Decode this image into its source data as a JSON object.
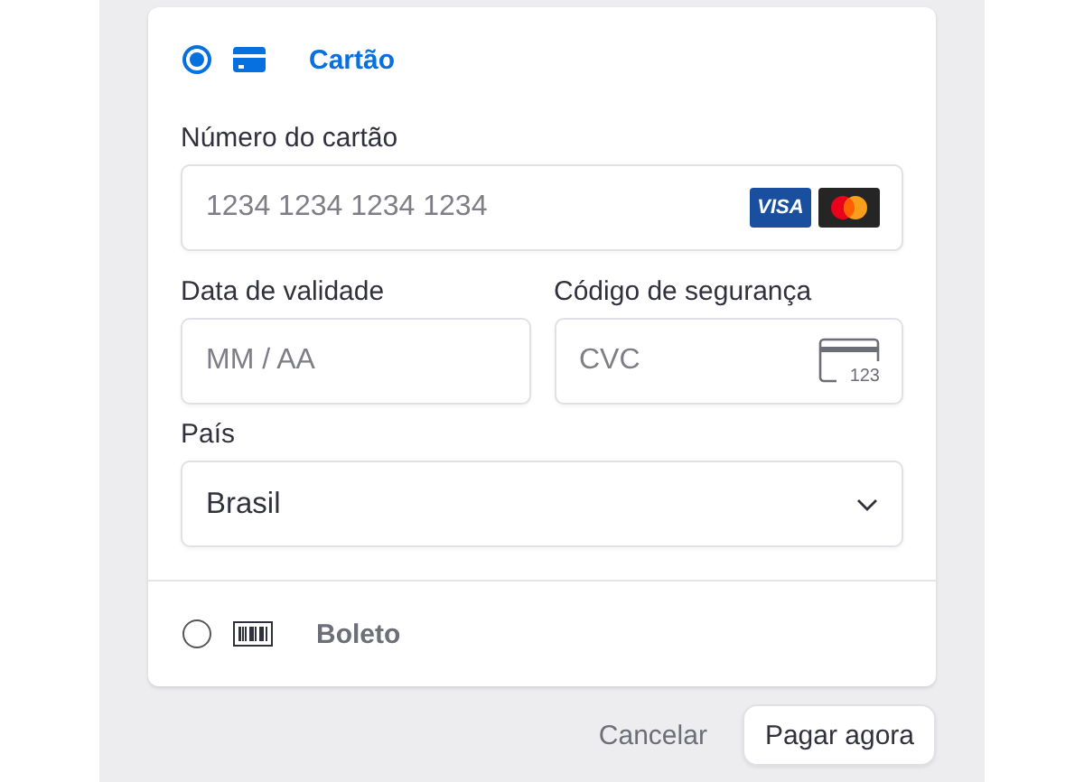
{
  "methods": [
    {
      "kind": "card",
      "label": "Cartão",
      "selected": true,
      "card_number": {
        "label": "Número do cartão",
        "placeholder": "1234 1234 1234 1234",
        "brands": [
          {
            "kind": "visa",
            "label": "VISA"
          },
          {
            "kind": "mastercard"
          }
        ]
      },
      "expiry": {
        "label": "Data de validade",
        "placeholder": "MM / AA"
      },
      "cvc": {
        "label": "Código de segurança",
        "placeholder": "CVC",
        "icon_label": "123"
      },
      "country": {
        "label": "País",
        "value": "Brasil"
      }
    },
    {
      "kind": "boleto",
      "label": "Boleto",
      "selected": false
    }
  ],
  "buttons": {
    "cancel": "Cancelar",
    "pay": "Pagar agora"
  }
}
